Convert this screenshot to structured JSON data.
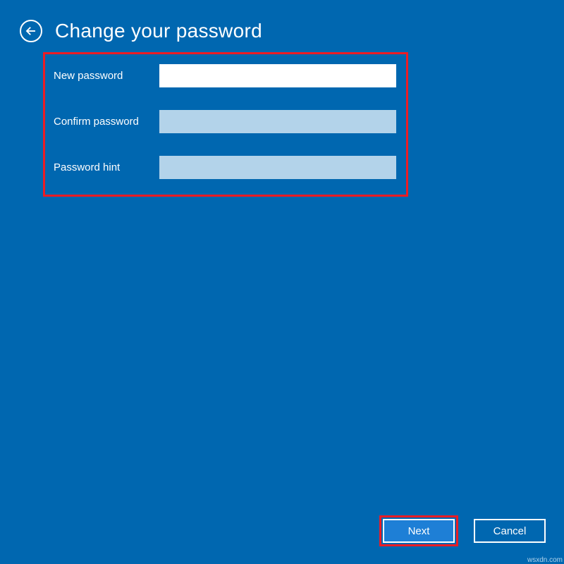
{
  "header": {
    "title": "Change your password"
  },
  "form": {
    "rows": [
      {
        "label": "New password",
        "value": "",
        "active": true
      },
      {
        "label": "Confirm password",
        "value": "",
        "active": false
      },
      {
        "label": "Password hint",
        "value": "",
        "active": false
      }
    ]
  },
  "buttons": {
    "next": "Next",
    "cancel": "Cancel"
  },
  "watermark": "wsxdn.com",
  "colors": {
    "background": "#0067b0",
    "highlight": "#ec1c24",
    "primaryButton": "#1e7fd6",
    "inactiveInput": "#b3d3ea"
  }
}
